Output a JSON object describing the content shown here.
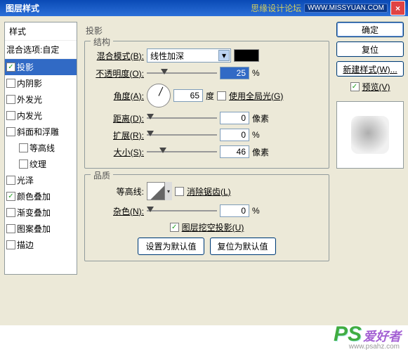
{
  "title": "图层样式",
  "forum": "思缘设计论坛",
  "url_badge": "WWW.MISSYUAN.COM",
  "styles_panel": {
    "header": "样式",
    "blend": "混合选项:自定",
    "items": [
      {
        "label": "投影",
        "checked": true,
        "selected": true
      },
      {
        "label": "内阴影",
        "checked": false
      },
      {
        "label": "外发光",
        "checked": false
      },
      {
        "label": "内发光",
        "checked": false
      },
      {
        "label": "斜面和浮雕",
        "checked": false
      },
      {
        "label": "等高线",
        "checked": false,
        "child": true
      },
      {
        "label": "纹理",
        "checked": false,
        "child": true
      },
      {
        "label": "光泽",
        "checked": false
      },
      {
        "label": "颜色叠加",
        "checked": true
      },
      {
        "label": "渐变叠加",
        "checked": false
      },
      {
        "label": "图案叠加",
        "checked": false
      },
      {
        "label": "描边",
        "checked": false
      }
    ]
  },
  "center": {
    "heading": "投影",
    "structure": {
      "legend": "结构",
      "blend_mode_label": "混合模式(B):",
      "blend_mode_value": "线性加深",
      "opacity_label": "不透明度(O):",
      "opacity_value": "25",
      "opacity_unit": "%",
      "angle_label": "角度(A):",
      "angle_value": "65",
      "angle_unit": "度",
      "global_light_label": "使用全局光(G)",
      "distance_label": "距离(D):",
      "distance_value": "0",
      "distance_unit": "像素",
      "spread_label": "扩展(R):",
      "spread_value": "0",
      "spread_unit": "%",
      "size_label": "大小(S):",
      "size_value": "46",
      "size_unit": "像素"
    },
    "quality": {
      "legend": "品质",
      "contour_label": "等高线:",
      "antialias_label": "消除锯齿(L)",
      "noise_label": "杂色(N):",
      "noise_value": "0",
      "noise_unit": "%",
      "knockout_label": "图层挖空投影(U)",
      "make_default": "设置为默认值",
      "reset_default": "复位为默认值"
    }
  },
  "right": {
    "ok": "确定",
    "cancel": "复位",
    "new_style": "新建样式(W)...",
    "preview": "预览(V)"
  },
  "watermark": {
    "ps": "PS",
    "cn": "爱好者",
    "url": "www.psahz.com"
  }
}
